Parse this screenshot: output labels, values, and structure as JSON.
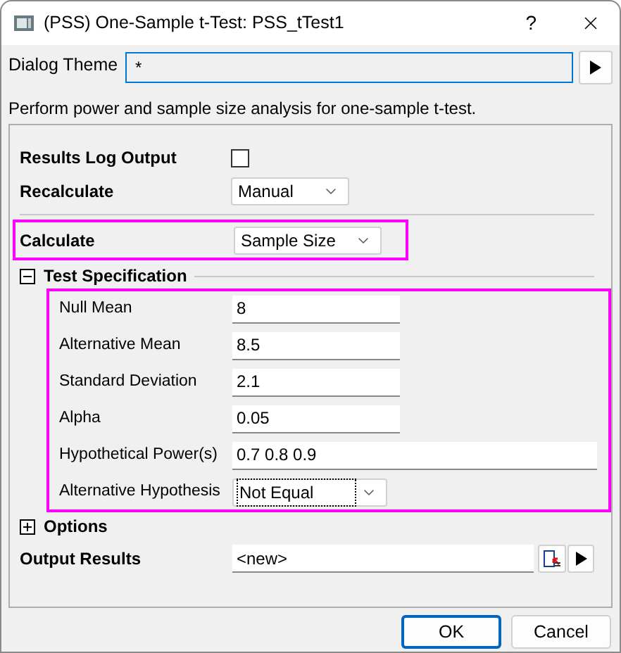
{
  "window": {
    "title": "(PSS) One-Sample t-Test: PSS_tTest1",
    "help": "?"
  },
  "dialog_theme": {
    "label": "Dialog Theme",
    "value": "*"
  },
  "description": "Perform power and sample size analysis for one-sample t-test.",
  "results_log_output": {
    "label": "Results Log Output",
    "checked": false
  },
  "recalculate": {
    "label": "Recalculate",
    "value": "Manual"
  },
  "calculate": {
    "label": "Calculate",
    "value": "Sample Size"
  },
  "test_specification": {
    "label": "Test Specification",
    "expanded": true,
    "fields": [
      {
        "label": "Null Mean",
        "value": "8",
        "kind": "number"
      },
      {
        "label": "Alternative Mean",
        "value": "8.5",
        "kind": "number"
      },
      {
        "label": "Standard Deviation",
        "value": "2.1",
        "kind": "number"
      },
      {
        "label": "Alpha",
        "value": "0.05",
        "kind": "number"
      },
      {
        "label": "Hypothetical Power(s)",
        "value": "0.7 0.8 0.9",
        "kind": "list"
      },
      {
        "label": "Alternative Hypothesis",
        "value": "Not Equal",
        "kind": "dropdown",
        "focused": true
      }
    ]
  },
  "options": {
    "label": "Options",
    "expanded": false
  },
  "output_results": {
    "label": "Output Results",
    "value": "<new>"
  },
  "buttons": [
    {
      "label": "OK",
      "default": true
    },
    {
      "label": "Cancel",
      "default": false
    }
  ]
}
